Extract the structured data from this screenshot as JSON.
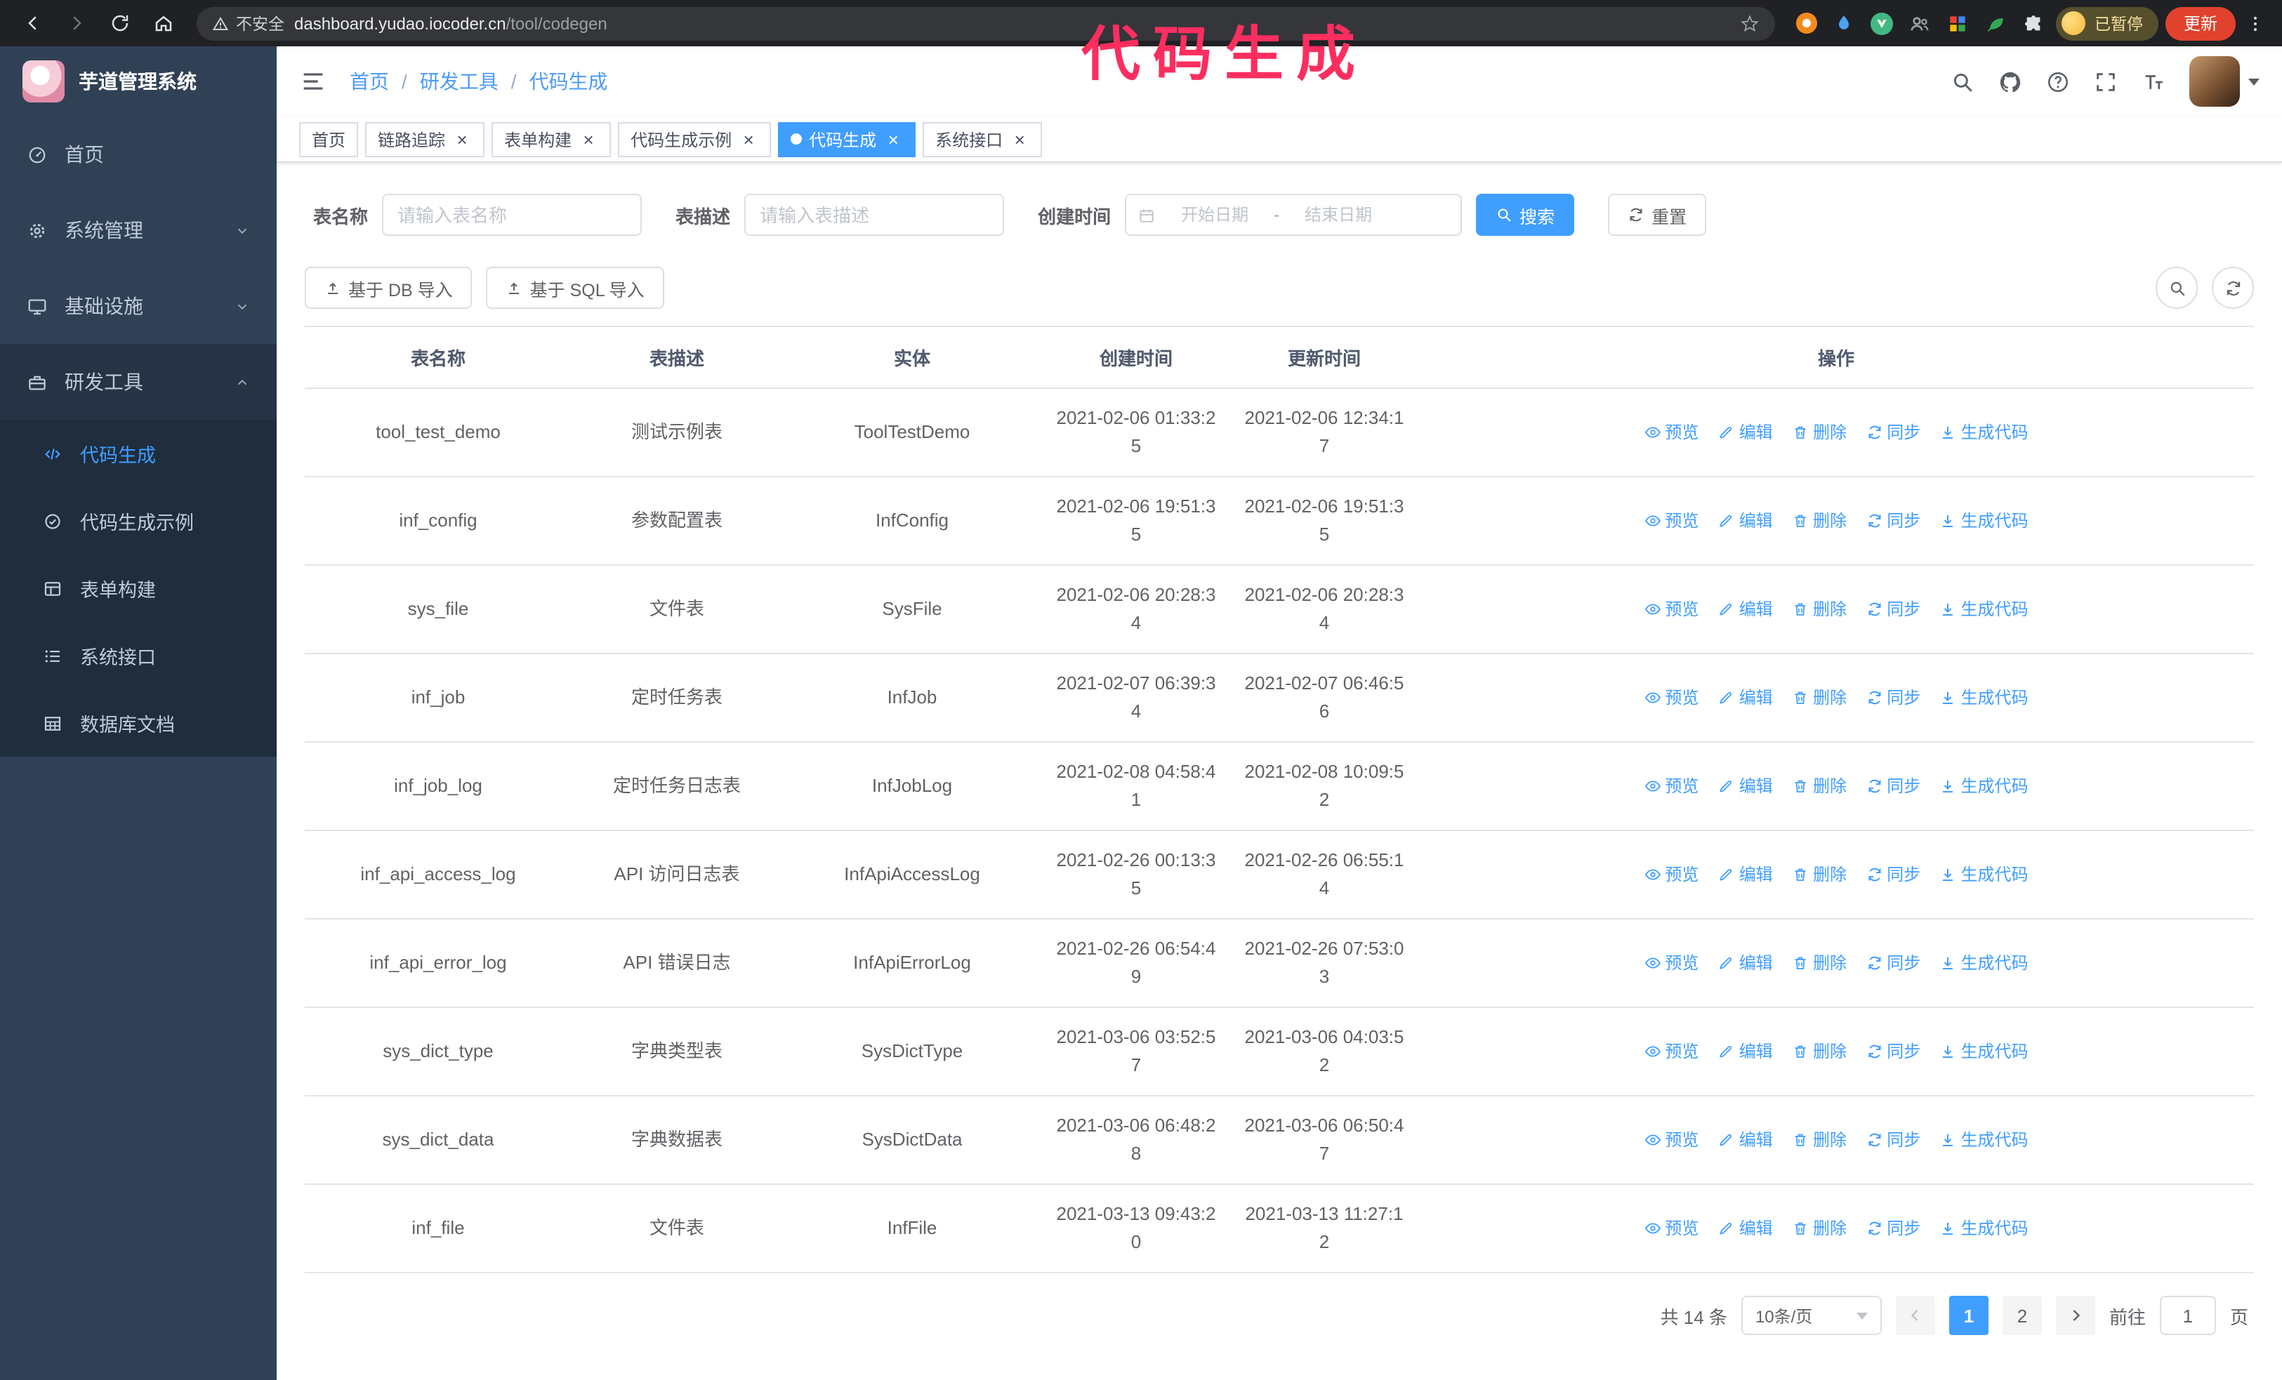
{
  "browser": {
    "security_label": "不安全",
    "url_host": "dashboard.yudao.iocoder.cn",
    "url_path": "/tool/codegen",
    "paused_badge": "已暂停",
    "update_button": "更新"
  },
  "annotation": {
    "text": "代码生成",
    "color": "#fb2e5f"
  },
  "sidebar": {
    "title": "芋道管理系统",
    "items": [
      {
        "label": "首页"
      },
      {
        "label": "系统管理"
      },
      {
        "label": "基础设施"
      },
      {
        "label": "研发工具"
      }
    ],
    "subitems": [
      {
        "label": "代码生成",
        "active": true
      },
      {
        "label": "代码生成示例"
      },
      {
        "label": "表单构建"
      },
      {
        "label": "系统接口"
      },
      {
        "label": "数据库文档"
      }
    ]
  },
  "navbar": {
    "breadcrumb": [
      "首页",
      "研发工具",
      "代码生成"
    ],
    "separator": "/"
  },
  "tags": {
    "close_glyph": "×",
    "items": [
      {
        "label": "首页",
        "closable": false,
        "active": false
      },
      {
        "label": "链路追踪",
        "closable": true,
        "active": false
      },
      {
        "label": "表单构建",
        "closable": true,
        "active": false
      },
      {
        "label": "代码生成示例",
        "closable": true,
        "active": false
      },
      {
        "label": "代码生成",
        "closable": true,
        "active": true
      },
      {
        "label": "系统接口",
        "closable": true,
        "active": false
      }
    ]
  },
  "search": {
    "name_label": "表名称",
    "name_placeholder": "请输入表名称",
    "desc_label": "表描述",
    "desc_placeholder": "请输入表描述",
    "time_label": "创建时间",
    "time_start_placeholder": "开始日期",
    "time_separator": "-",
    "time_end_placeholder": "结束日期",
    "search_button": "搜索",
    "reset_button": "重置"
  },
  "toolbar": {
    "import_db": "基于 DB 导入",
    "import_sql": "基于 SQL 导入"
  },
  "table": {
    "columns": [
      "表名称",
      "表描述",
      "实体",
      "创建时间",
      "更新时间",
      "操作"
    ],
    "actions": [
      "预览",
      "编辑",
      "删除",
      "同步",
      "生成代码"
    ],
    "rows": [
      {
        "name": "tool_test_demo",
        "desc": "测试示例表",
        "entity": "ToolTestDemo",
        "create_time": "2021-02-06 01:33:25",
        "update_time": "2021-02-06 12:34:17"
      },
      {
        "name": "inf_config",
        "desc": "参数配置表",
        "entity": "InfConfig",
        "create_time": "2021-02-06 19:51:35",
        "update_time": "2021-02-06 19:51:35"
      },
      {
        "name": "sys_file",
        "desc": "文件表",
        "entity": "SysFile",
        "create_time": "2021-02-06 20:28:34",
        "update_time": "2021-02-06 20:28:34"
      },
      {
        "name": "inf_job",
        "desc": "定时任务表",
        "entity": "InfJob",
        "create_time": "2021-02-07 06:39:34",
        "update_time": "2021-02-07 06:46:56"
      },
      {
        "name": "inf_job_log",
        "desc": "定时任务日志表",
        "entity": "InfJobLog",
        "create_time": "2021-02-08 04:58:41",
        "update_time": "2021-02-08 10:09:52"
      },
      {
        "name": "inf_api_access_log",
        "desc": "API 访问日志表",
        "entity": "InfApiAccessLog",
        "create_time": "2021-02-26 00:13:35",
        "update_time": "2021-02-26 06:55:14"
      },
      {
        "name": "inf_api_error_log",
        "desc": "API 错误日志",
        "entity": "InfApiErrorLog",
        "create_time": "2021-02-26 06:54:49",
        "update_time": "2021-02-26 07:53:03"
      },
      {
        "name": "sys_dict_type",
        "desc": "字典类型表",
        "entity": "SysDictType",
        "create_time": "2021-03-06 03:52:57",
        "update_time": "2021-03-06 04:03:52"
      },
      {
        "name": "sys_dict_data",
        "desc": "字典数据表",
        "entity": "SysDictData",
        "create_time": "2021-03-06 06:48:28",
        "update_time": "2021-03-06 06:50:47"
      },
      {
        "name": "inf_file",
        "desc": "文件表",
        "entity": "InfFile",
        "create_time": "2021-03-13 09:43:20",
        "update_time": "2021-03-13 11:27:12"
      }
    ]
  },
  "pagination": {
    "total": "共 14 条",
    "page_size": "10条/页",
    "pages": [
      "1",
      "2"
    ],
    "current": "1",
    "goto_label": "前往",
    "goto_value": "1",
    "goto_suffix": "页"
  },
  "colors": {
    "primary": "#409eff",
    "sidebar_bg": "#304156",
    "submenu_bg": "#1f2d3d",
    "annotation": "#fb2e5f"
  }
}
